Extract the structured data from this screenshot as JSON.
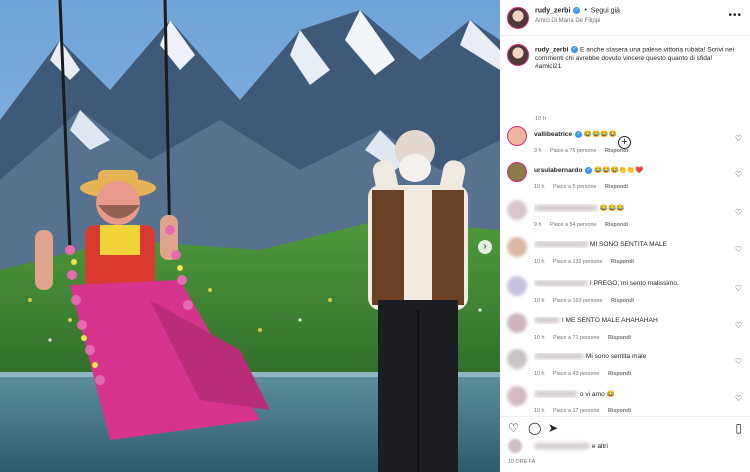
{
  "header": {
    "username": "rudy_zerbi",
    "separator": "•",
    "follow_label": "Segui già",
    "subtitle": "Amici Di Maria De Filippi",
    "more_label": "•••"
  },
  "caption": {
    "username": "rudy_zerbi",
    "text": "E anche stasera una palese vittoria rubata! Scrivi nei commenti chi avrebbe dovuto vincere questo quanto di sfida! #amici21",
    "time": "10 h",
    "add_label": "+"
  },
  "comments": [
    {
      "user": "vallibeatrice",
      "text": "😂😂😂😂",
      "time": "9 h",
      "likes": "Piace a 76 persone",
      "reply": "Rispondi"
    },
    {
      "user": "ursulabernardo",
      "text": "😂😂😂👏👏❤️",
      "time": "10 h",
      "likes": "Piace a 5 persone",
      "reply": "Rispondi"
    },
    {
      "user": "",
      "text": "😂😂😂",
      "time": "9 h",
      "likes": "Piace a 54 persone",
      "reply": "Rispondi"
    },
    {
      "user": "",
      "text": "MI SONO SENTITA MALE",
      "time": "10 h",
      "likes": "Piace a 132 persone",
      "reply": "Rispondi"
    },
    {
      "user": "",
      "text": "I PREGO, mi sento malissimo.",
      "time": "10 h",
      "likes": "Piace a 163 persone",
      "reply": "Rispondi"
    },
    {
      "user": "",
      "text": "I ME SENTO MALE AHAHAHAH",
      "time": "10 h",
      "likes": "Piace a 71 persone",
      "reply": "Rispondi"
    },
    {
      "user": "",
      "text": "Mi sono sentita male",
      "time": "10 h",
      "likes": "Piace a 43 persone",
      "reply": "Rispondi"
    },
    {
      "user": "",
      "text": "o vi amo 😂",
      "time": "10 h",
      "likes": "Piace a 17 persone",
      "reply": "Rispondi"
    }
  ],
  "actions": {
    "like_icon": "♡",
    "comment_icon": "◯",
    "share_icon": "➤",
    "save_icon": "▯",
    "likes_suffix": "e altri",
    "date": "10 ORE FA"
  },
  "media": {
    "next_label": "›"
  },
  "colors": {
    "verified": "#3897f0",
    "story_ring": "#d62976",
    "secondary_text": "#737373"
  }
}
